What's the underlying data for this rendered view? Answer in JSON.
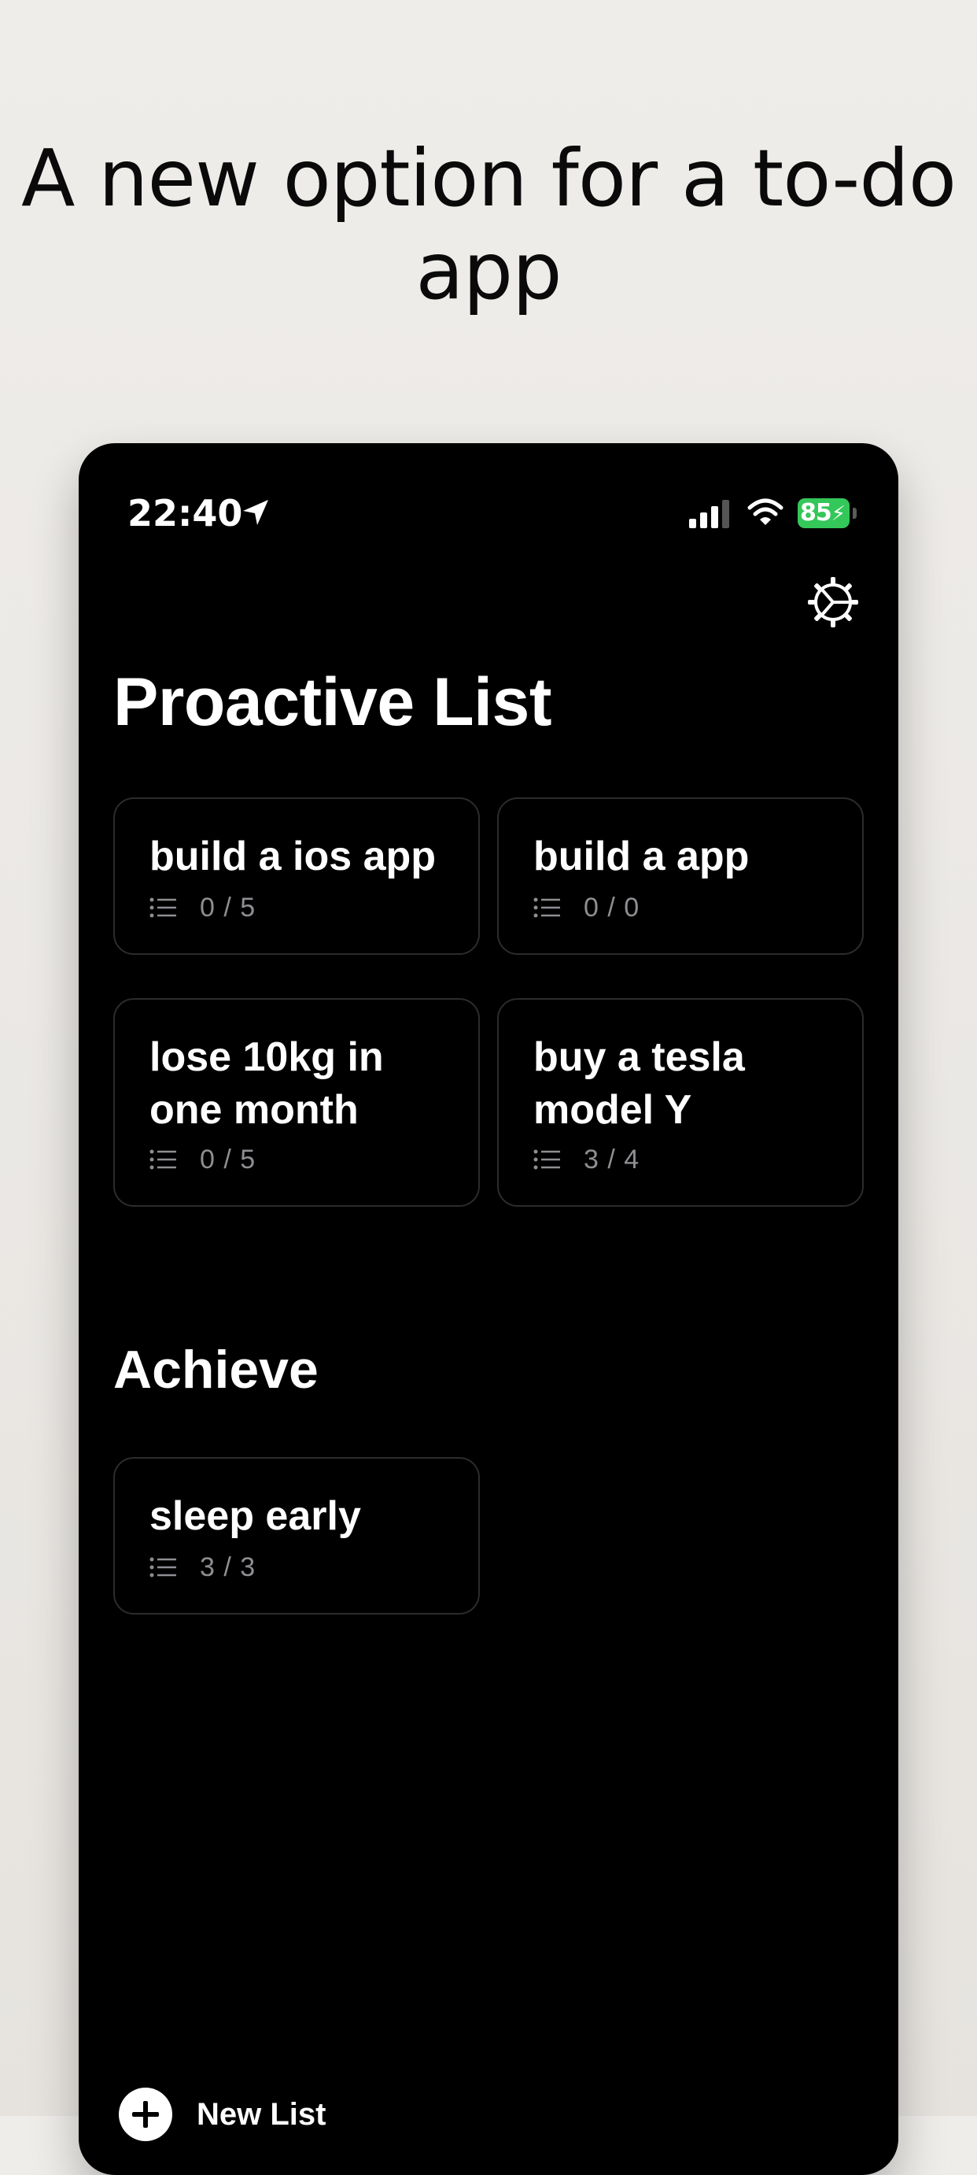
{
  "headline": {
    "line1": "A new option for a to-do",
    "line2": "app"
  },
  "status_bar": {
    "time": "22:40",
    "battery": "85",
    "icons": [
      "location-arrow-icon",
      "signal-icon",
      "wifi-icon",
      "battery-charging-icon"
    ]
  },
  "header": {
    "settings_icon": "gear-icon",
    "title": "Proactive List"
  },
  "lists": [
    {
      "title": "build a ios app",
      "count": "0 / 5"
    },
    {
      "title": "build a app",
      "count": "0 / 0"
    },
    {
      "title": "lose 10kg in one month",
      "count": "0 / 5"
    },
    {
      "title": "buy a tesla model Y",
      "count": "3 / 4"
    }
  ],
  "achieve": {
    "title": "Achieve",
    "items": [
      {
        "title": "sleep early",
        "count": "3 / 3"
      }
    ]
  },
  "footer": {
    "new_list_label": "New List",
    "icon": "plus-circle-icon"
  },
  "colors": {
    "battery": "#34c759",
    "card_border": "#2c2c2e",
    "muted_text": "#8e8e93"
  }
}
